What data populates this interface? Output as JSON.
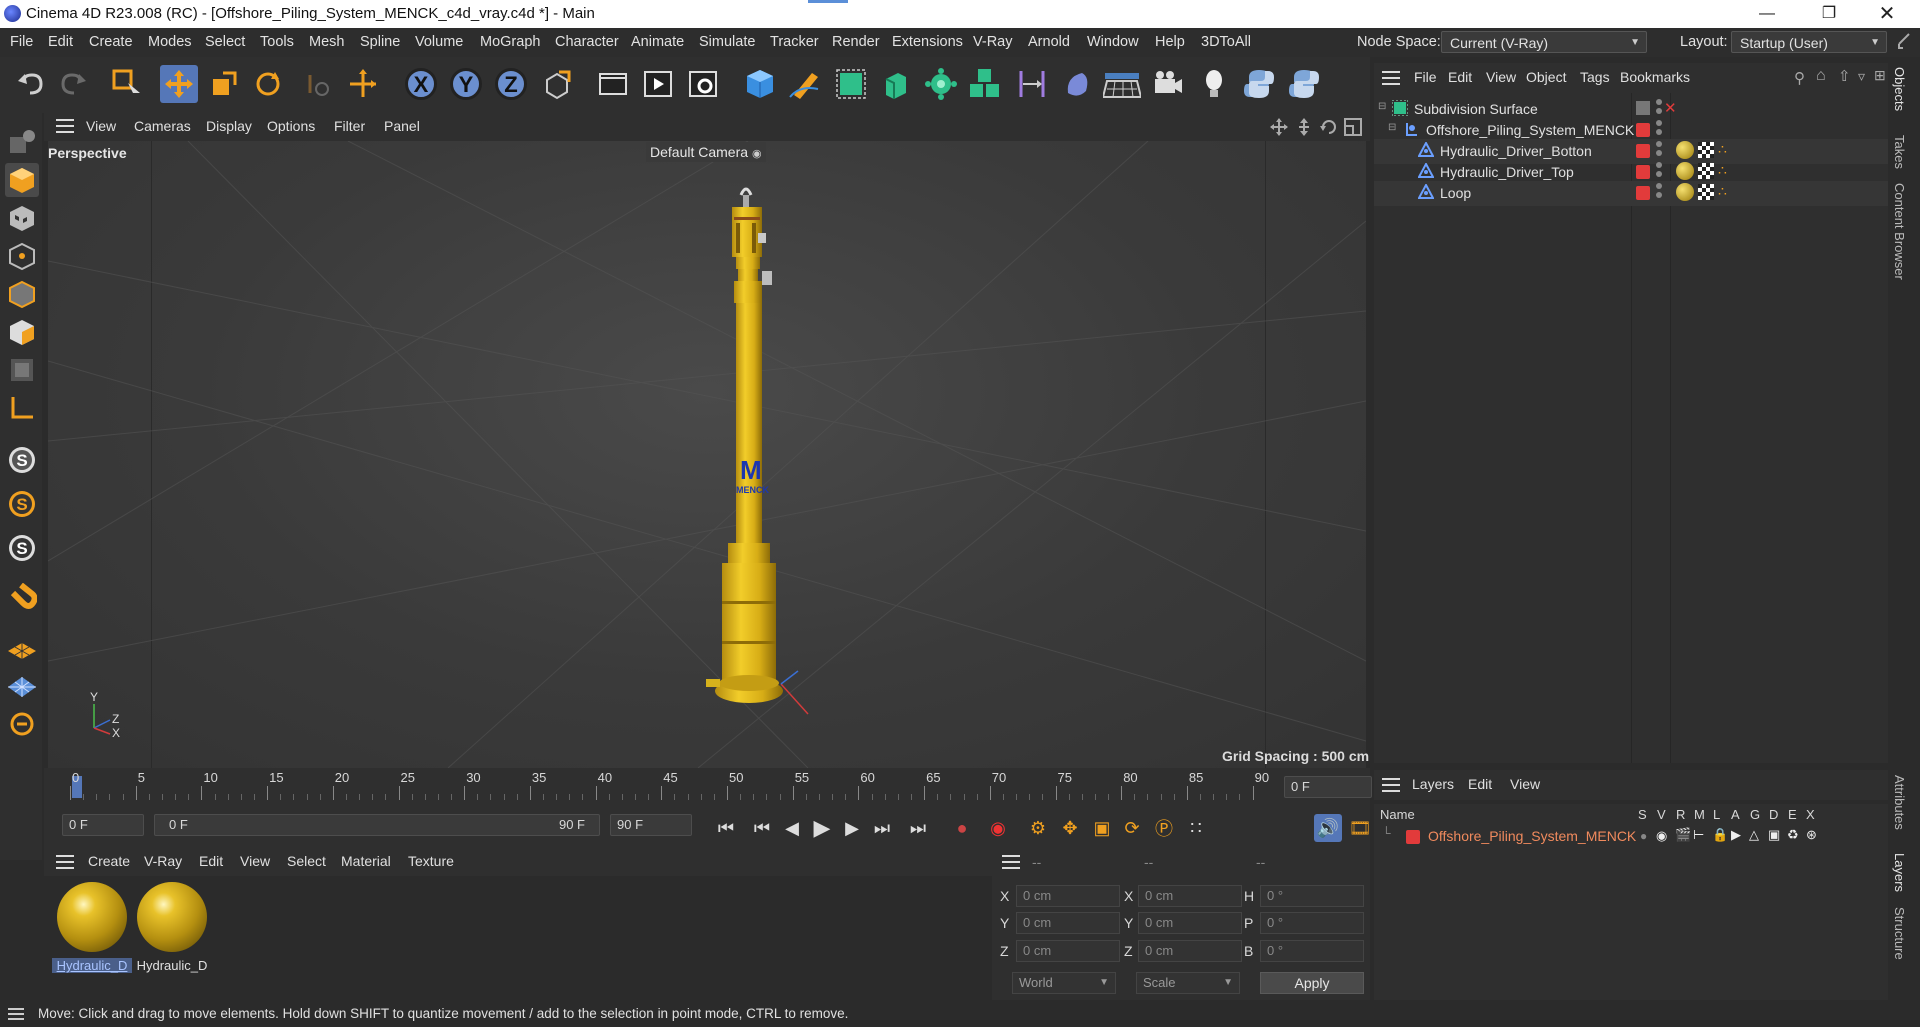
{
  "window": {
    "title": "Cinema 4D R23.008 (RC) - [Offshore_Piling_System_MENCK_c4d_vray.c4d *] - Main",
    "controls": [
      "minimize-icon",
      "restore-icon",
      "close-icon"
    ]
  },
  "menubar": {
    "items": [
      "File",
      "Edit",
      "Create",
      "Modes",
      "Select",
      "Tools",
      "Mesh",
      "Spline",
      "Volume",
      "MoGraph",
      "Character",
      "Animate",
      "Simulate",
      "Tracker",
      "Render",
      "Extensions",
      "V-Ray",
      "Arnold",
      "Window",
      "Help",
      "3DToAll"
    ],
    "node_space_label": "Node Space:",
    "node_space_value": "Current (V-Ray)",
    "layout_label": "Layout:",
    "layout_value": "Startup (User)"
  },
  "toolbar": {
    "icons": [
      "undo-icon",
      "redo-icon",
      "live-selection-icon",
      "move-icon",
      "scale-icon",
      "rotate-icon",
      "recent-tool-icon",
      "world-axis-icon",
      "x-axis-lock-icon",
      "y-axis-lock-icon",
      "z-axis-lock-icon",
      "coordinate-system-icon",
      "render-region-icon",
      "render-view-icon",
      "render-settings-icon",
      "cube-icon",
      "pen-icon",
      "subdivision-icon",
      "extrude-icon",
      "mograph-cloner-icon",
      "array-icon",
      "deformer-icon",
      "field-icon",
      "floor-icon",
      "camera-icon",
      "light-icon",
      "python-icon",
      "python-script-icon"
    ],
    "axis_labels": [
      "X",
      "Y",
      "Z"
    ]
  },
  "viewport": {
    "menu": [
      "View",
      "Cameras",
      "Display",
      "Options",
      "Filter",
      "Panel"
    ],
    "view_name": "Perspective",
    "camera_name": "Default Camera",
    "grid_spacing": "Grid Spacing : 500 cm",
    "axis_labels": [
      "Y",
      "Z",
      "X"
    ],
    "model_text": "MENCK"
  },
  "timeline": {
    "ticks": [
      "0",
      "5",
      "10",
      "15",
      "20",
      "25",
      "30",
      "35",
      "40",
      "45",
      "50",
      "55",
      "60",
      "65",
      "70",
      "75",
      "80",
      "85",
      "90"
    ],
    "current_frame": "0 F",
    "start_field": "0 F",
    "range_start": "0 F",
    "range_end": "90 F",
    "end_field": "90 F"
  },
  "material_manager": {
    "menu": [
      "Create",
      "V-Ray",
      "Edit",
      "View",
      "Select",
      "Material",
      "Texture"
    ],
    "materials": [
      {
        "label": "Hydraulic_D",
        "selected": true
      },
      {
        "label": "Hydraulic_D",
        "selected": false
      }
    ]
  },
  "coordinates": {
    "header": [
      "--",
      "--",
      "--"
    ],
    "rows": [
      {
        "pos_label": "X",
        "pos_value": "0 cm",
        "size_label": "X",
        "size_value": "0 cm",
        "rot_label": "H",
        "rot_value": "0 °"
      },
      {
        "pos_label": "Y",
        "pos_value": "0 cm",
        "size_label": "Y",
        "size_value": "0 cm",
        "rot_label": "P",
        "rot_value": "0 °"
      },
      {
        "pos_label": "Z",
        "pos_value": "0 cm",
        "size_label": "Z",
        "size_value": "0 cm",
        "rot_label": "B",
        "rot_value": "0 °"
      }
    ],
    "mode_value": "World",
    "transform_value": "Scale",
    "apply_label": "Apply"
  },
  "object_manager": {
    "menu": [
      "File",
      "Edit",
      "View",
      "Object",
      "Tags",
      "Bookmarks"
    ],
    "objects": [
      {
        "name": "Subdivision Surface",
        "indent": 0
      },
      {
        "name": "Offshore_Piling_System_MENCK",
        "indent": 1
      },
      {
        "name": "Hydraulic_Driver_Botton",
        "indent": 2
      },
      {
        "name": "Hydraulic_Driver_Top",
        "indent": 2
      },
      {
        "name": "Loop",
        "indent": 2
      }
    ]
  },
  "layers": {
    "menu": [
      "Layers",
      "Edit",
      "View"
    ],
    "columns": [
      "Name",
      "S",
      "V",
      "R",
      "M",
      "L",
      "A",
      "G",
      "D",
      "E",
      "X"
    ],
    "items": [
      {
        "name": "Offshore_Piling_System_MENCK",
        "color": "#e23b3b"
      }
    ]
  },
  "right_tabs": [
    "Objects",
    "Takes",
    "Content Browser",
    "Attributes",
    "Layers",
    "Structure"
  ],
  "status": {
    "text": "Move: Click and drag to move elements. Hold down SHIFT to quantize movement / add to the selection in point mode, CTRL to remove."
  },
  "colors": {
    "accent": "#5577b8",
    "object_yellow": "#e7c11f",
    "layer_red": "#e23b3b",
    "layer_text": "#f08a5d"
  }
}
